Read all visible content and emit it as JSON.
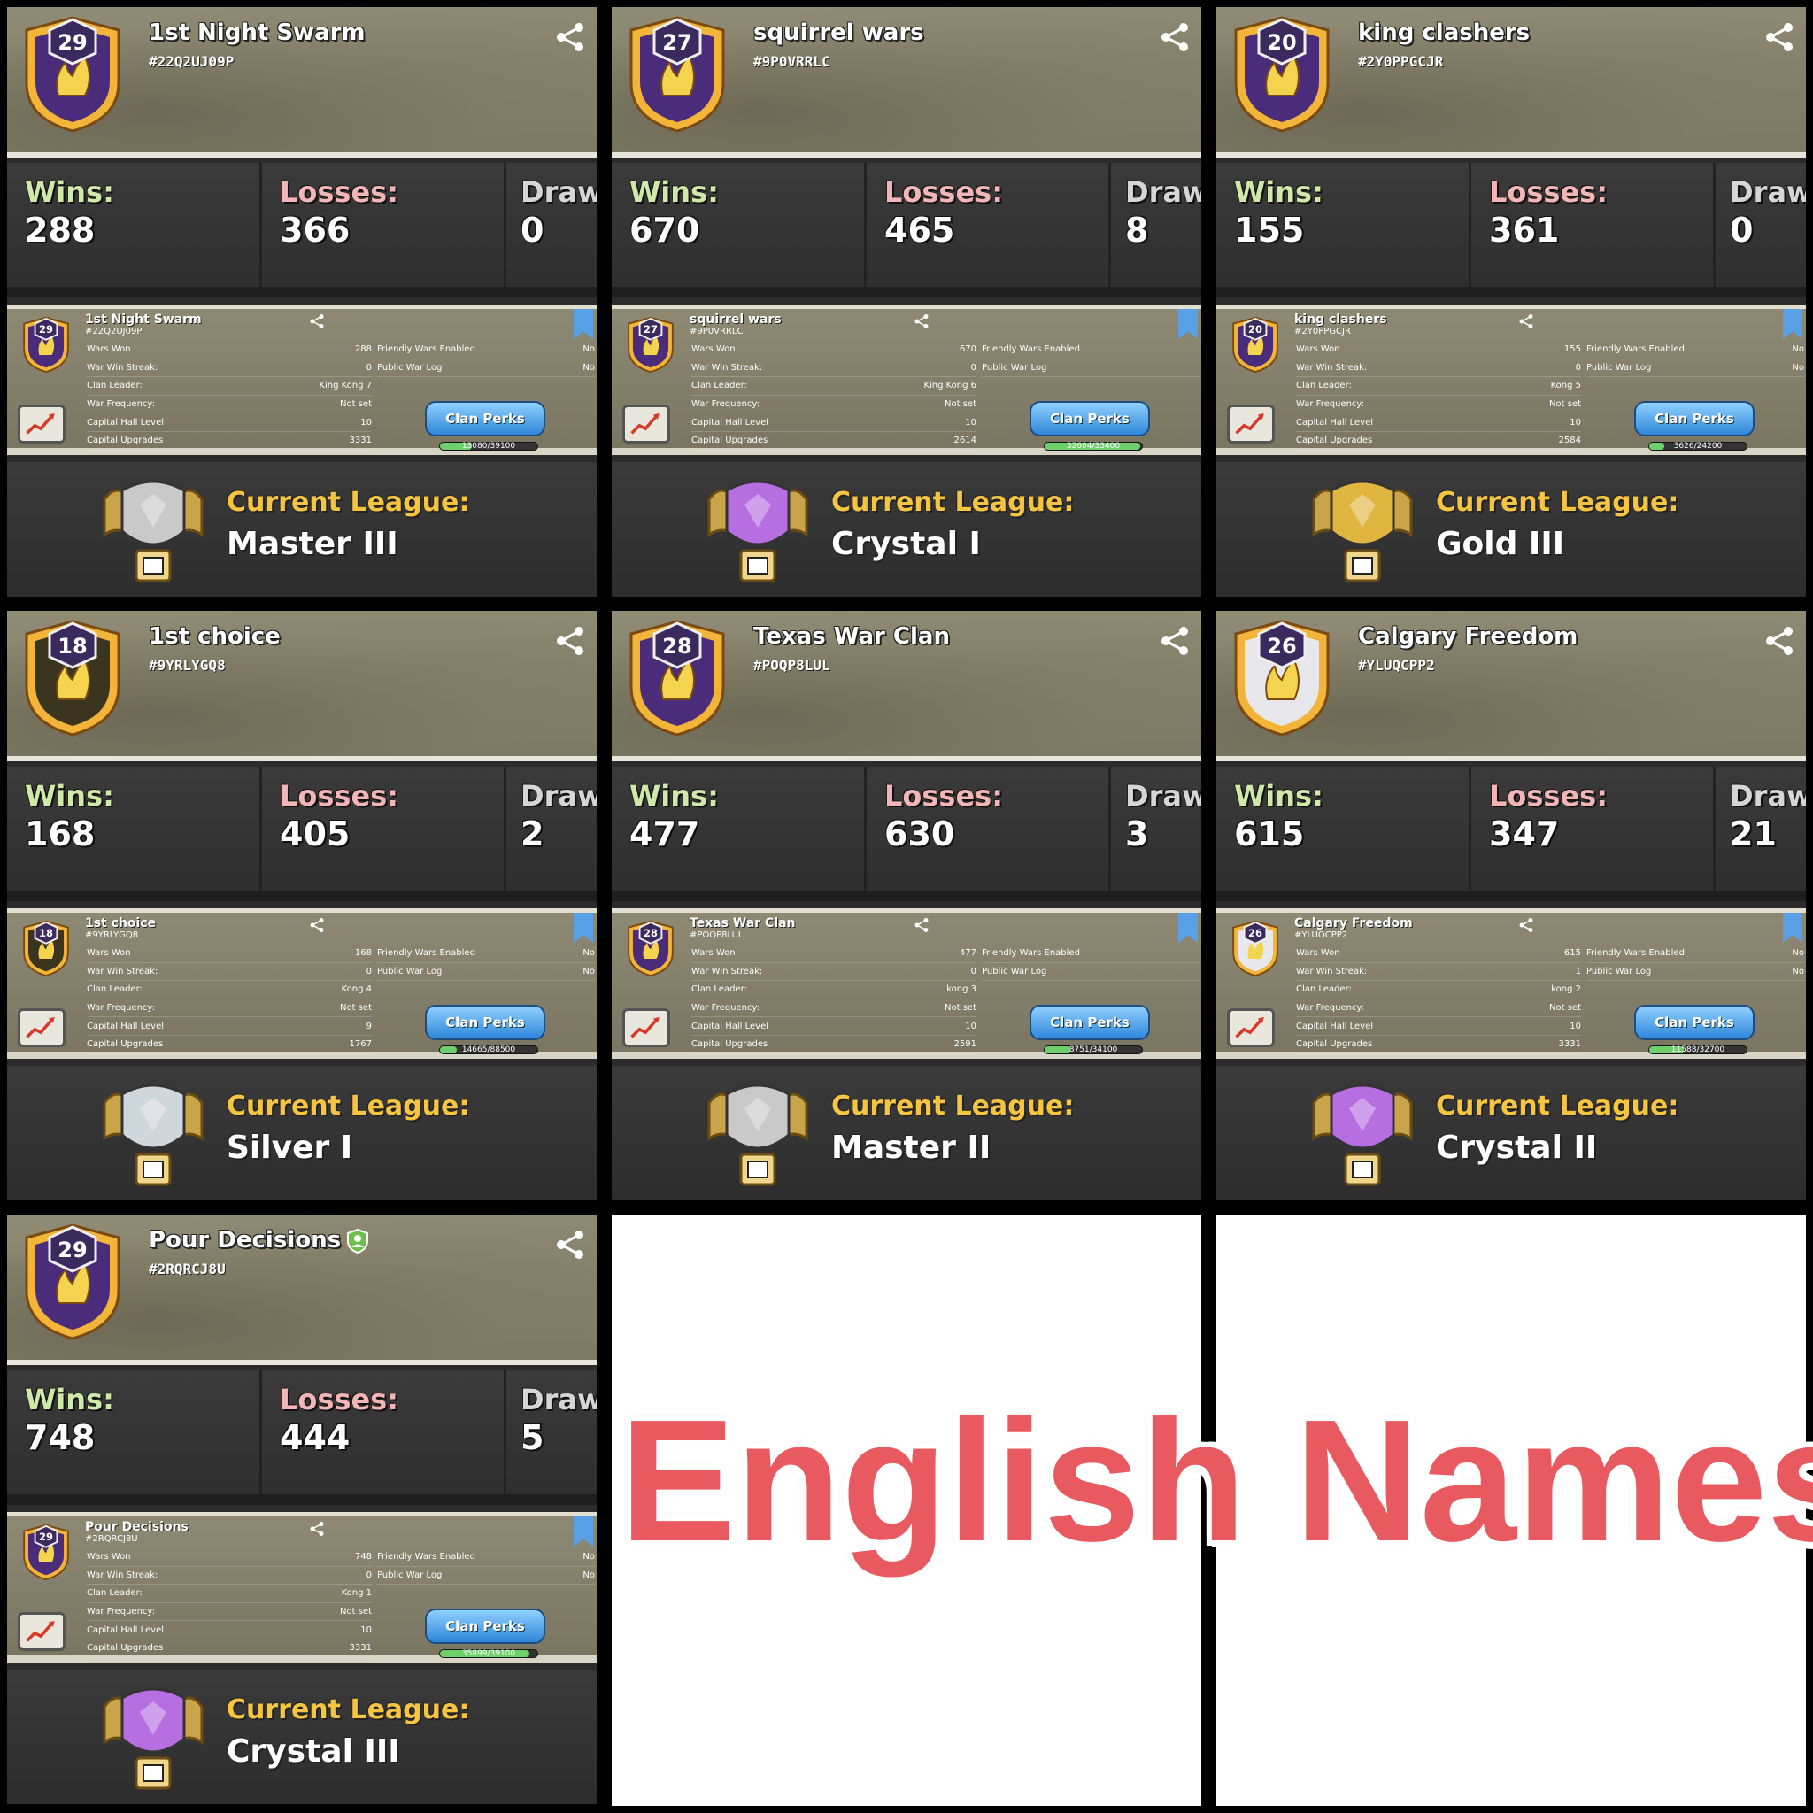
{
  "labels": {
    "wins": "Wins:",
    "losses": "Losses:",
    "draws": "Draw",
    "current_league": "Current League:",
    "wars_won": "Wars Won",
    "war_win_streak": "War Win Streak:",
    "clan_leader": "Clan Leader:",
    "war_frequency": "War Frequency:",
    "capital_hall_level": "Capital Hall Level",
    "capital_upgrades": "Capital Upgrades",
    "friendly_wars_enabled": "Friendly Wars Enabled",
    "public_war_log": "Public War Log",
    "clan_perks": "Clan Perks"
  },
  "clans": [
    {
      "level": "29",
      "name": "1st Night Swarm",
      "tag": "#22Q2UJ09P",
      "wins": "288",
      "losses": "366",
      "draws": "0",
      "wars_won": "288",
      "win_streak": "0",
      "leader": "King Kong 7",
      "war_frequency": "Not set",
      "capital_hall": "10",
      "capital_upgrades": "3331",
      "friendly_wars": "No",
      "public_log": "No",
      "perks_progress": "13080/39100",
      "progress": 0.33,
      "league": "Master III",
      "league_color": "#c9c9c9",
      "badge_color": "#4a2c7a",
      "verified": false
    },
    {
      "level": "27",
      "name": "squirrel wars",
      "tag": "#9P0VRRLC",
      "wins": "670",
      "losses": "465",
      "draws": "8",
      "wars_won": "670",
      "win_streak": "0",
      "leader": "King Kong 6",
      "war_frequency": "Not set",
      "capital_hall": "10",
      "capital_upgrades": "2614",
      "friendly_wars": "",
      "public_log": "",
      "perks_progress": "32604/33400",
      "progress": 0.98,
      "league": "Crystal I",
      "league_color": "#b66ee0",
      "badge_color": "#4a2c7a",
      "verified": false
    },
    {
      "level": "20",
      "name": "king clashers",
      "tag": "#2Y0PPGCJR",
      "wins": "155",
      "losses": "361",
      "draws": "0",
      "wars_won": "155",
      "win_streak": "0",
      "leader": "Kong 5",
      "war_frequency": "Not set",
      "capital_hall": "10",
      "capital_upgrades": "2584",
      "friendly_wars": "No",
      "public_log": "No",
      "perks_progress": "3626/24200",
      "progress": 0.15,
      "league": "Gold III",
      "league_color": "#e0b640",
      "badge_color": "#4a2c7a",
      "verified": false
    },
    {
      "level": "18",
      "name": "1st choice",
      "tag": "#9YRLYGQ8",
      "wins": "168",
      "losses": "405",
      "draws": "2",
      "wars_won": "168",
      "win_streak": "0",
      "leader": "Kong 4",
      "war_frequency": "Not set",
      "capital_hall": "9",
      "capital_upgrades": "1767",
      "friendly_wars": "No",
      "public_log": "No",
      "perks_progress": "14665/88500",
      "progress": 0.17,
      "league": "Silver I",
      "league_color": "#cfd6dc",
      "badge_color": "#3b3520",
      "verified": false
    },
    {
      "level": "28",
      "name": "Texas War Clan",
      "tag": "#POQP8LUL",
      "wins": "477",
      "losses": "630",
      "draws": "3",
      "wars_won": "477",
      "win_streak": "0",
      "leader": "kong 3",
      "war_frequency": "Not set",
      "capital_hall": "10",
      "capital_upgrades": "2591",
      "friendly_wars": "",
      "public_log": "",
      "perks_progress": "8751/34100",
      "progress": 0.26,
      "league": "Master II",
      "league_color": "#c9c9c9",
      "badge_color": "#4a2c7a",
      "verified": false
    },
    {
      "level": "26",
      "name": "Calgary Freedom",
      "tag": "#YLUQCPP2",
      "wins": "615",
      "losses": "347",
      "draws": "21",
      "wars_won": "615",
      "win_streak": "1",
      "leader": "kong 2",
      "war_frequency": "Not set",
      "capital_hall": "10",
      "capital_upgrades": "3331",
      "friendly_wars": "No",
      "public_log": "No",
      "perks_progress": "11588/32700",
      "progress": 0.35,
      "league": "Crystal II",
      "league_color": "#b66ee0",
      "badge_color": "#e8e8ec",
      "verified": false
    },
    {
      "level": "29",
      "name": "Pour Decisions",
      "tag": "#2RQRCJ8U",
      "wins": "748",
      "losses": "444",
      "draws": "5",
      "wars_won": "748",
      "win_streak": "0",
      "leader": "Kong 1",
      "war_frequency": "Not set",
      "capital_hall": "10",
      "capital_upgrades": "3331",
      "friendly_wars": "No",
      "public_log": "No",
      "perks_progress": "35899/39100",
      "progress": 0.92,
      "league": "Crystal III",
      "league_color": "#b66ee0",
      "badge_color": "#4a2c7a",
      "verified": true
    }
  ],
  "overlay_text": "English Names"
}
